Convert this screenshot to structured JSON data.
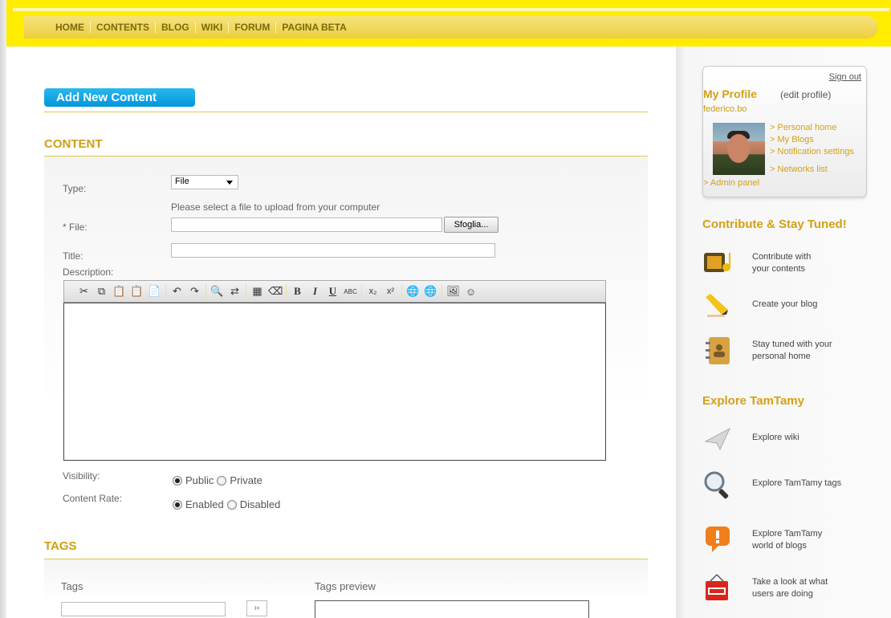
{
  "nav": [
    "HOME",
    "CONTENTS",
    "BLOG",
    "WIKI",
    "FORUM",
    "PAGINA BETA"
  ],
  "main": {
    "add_button": "Add New Content",
    "content_section": "CONTENT",
    "type_label": "Type:",
    "type_value": "File",
    "file_hint": "Please select a file to upload from your computer",
    "file_label": "* File:",
    "browse_button": "Sfoglia...",
    "title_label": "Title:",
    "description_label": "Description:",
    "visibility_label": "Visibility:",
    "visibility_options": [
      "Public",
      "Private"
    ],
    "visibility_selected": "Public",
    "rate_label": "Content Rate:",
    "rate_options": [
      "Enabled",
      "Disabled"
    ],
    "rate_selected": "Enabled",
    "tags_section": "TAGS",
    "tags_label": "Tags",
    "tags_preview_label": "Tags preview",
    "tags_add_button": "››"
  },
  "toolbar": {
    "buttons": [
      "cut-icon",
      "copy-icon",
      "paste-icon",
      "paste-text-icon",
      "paste-word-icon",
      "undo-icon",
      "redo-icon",
      "find-icon",
      "replace-icon",
      "select-all-icon",
      "remove-format-icon",
      "bold-icon",
      "italic-icon",
      "underline-icon",
      "strikethrough-icon",
      "subscript-icon",
      "superscript-icon",
      "link-icon",
      "unlink-icon",
      "image-icon",
      "smiley-icon"
    ]
  },
  "profile": {
    "sign_out": "Sign out",
    "title": "My Profile",
    "edit": "(edit profile)",
    "username": "federico.bo",
    "links": [
      "> Personal home",
      "> My Blogs",
      "> Notification settings",
      "> Networks list"
    ],
    "admin": "> Admin panel"
  },
  "contribute": {
    "title": "Contribute & Stay Tuned!",
    "items": [
      {
        "icon": "contribute-icon",
        "text1": "Contribute with",
        "text2": "your contents"
      },
      {
        "icon": "pencil-icon",
        "text1": "Create your blog",
        "text2": ""
      },
      {
        "icon": "address-book-icon",
        "text1": "Stay tuned with your",
        "text2": "personal home"
      }
    ]
  },
  "explore": {
    "title": "Explore TamTamy",
    "items": [
      {
        "icon": "paper-plane-icon",
        "text1": "Explore wiki",
        "text2": ""
      },
      {
        "icon": "magnifier-icon",
        "text1": "Explore TamTamy tags",
        "text2": ""
      },
      {
        "icon": "exclamation-bubble-icon",
        "text1": "Explore TamTamy",
        "text2": "world of blogs"
      },
      {
        "icon": "open-sign-icon",
        "text1": "Take a look at what",
        "text2": "users are doing"
      }
    ]
  },
  "colors": {
    "accent_yellow": "#ffec00",
    "title_gold": "#d4a017",
    "button_blue": "#0096d9"
  }
}
